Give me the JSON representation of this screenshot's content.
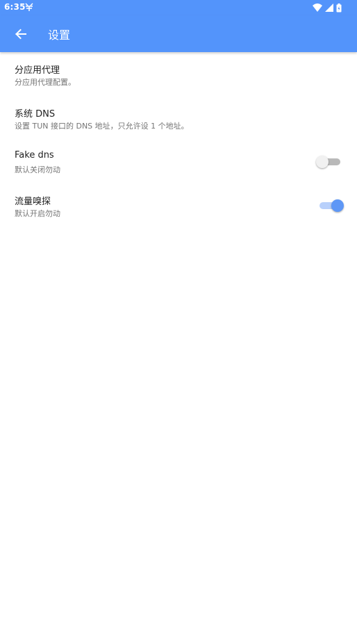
{
  "status_bar": {
    "time": "6:35",
    "icons": [
      "notification-icon",
      "wifi-icon",
      "signal-icon",
      "battery-icon"
    ]
  },
  "app_bar": {
    "title": "设置",
    "back_icon": "arrow-back-icon",
    "color": "#5394fb"
  },
  "settings": [
    {
      "title": "分应用代理",
      "subtitle": "分应用代理配置。"
    },
    {
      "title": "系统 DNS",
      "subtitle": "设置 TUN 接口的 DNS 地址，只允许设 1 个地址。"
    },
    {
      "title": "Fake dns",
      "subtitle": "默认关闭勿动",
      "switch": false
    },
    {
      "title": "流量嗅探",
      "subtitle": "默认开启勿动",
      "switch": true
    }
  ],
  "colors": {
    "accent": "#5e97f6",
    "switch_on_track": "#b8d0fb",
    "switch_off_track": "#b9b9b9"
  }
}
